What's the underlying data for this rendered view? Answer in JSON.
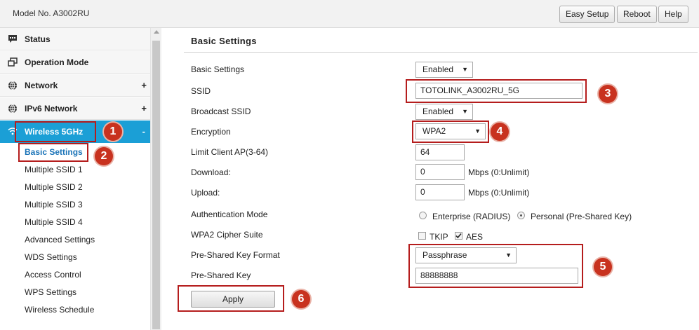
{
  "header": {
    "model": "Model No. A3002RU",
    "buttons": {
      "easy_setup": "Easy Setup",
      "reboot": "Reboot",
      "help": "Help"
    }
  },
  "sidebar": {
    "menu": [
      {
        "label": "Status",
        "icon": "comment-icon",
        "expandable": false
      },
      {
        "label": "Operation Mode",
        "icon": "windows-icon",
        "expandable": false
      },
      {
        "label": "Network",
        "icon": "globe-icon",
        "expandable": true,
        "marker": "+"
      },
      {
        "label": "IPv6 Network",
        "icon": "globe-icon",
        "expandable": true,
        "marker": "+"
      },
      {
        "label": "Wireless 5GHz",
        "icon": "wifi-icon",
        "expandable": true,
        "marker": "-",
        "active": true
      }
    ],
    "submenu": [
      "Basic Settings",
      "Multiple SSID 1",
      "Multiple SSID 2",
      "Multiple SSID 3",
      "Multiple SSID 4",
      "Advanced Settings",
      "WDS Settings",
      "Access Control",
      "WPS Settings",
      "Wireless Schedule"
    ],
    "active_submenu": "Basic Settings"
  },
  "main": {
    "title": "Basic Settings",
    "fields": {
      "basic_settings": {
        "label": "Basic Settings",
        "value": "Enabled"
      },
      "ssid": {
        "label": "SSID",
        "value": "TOTOLINK_A3002RU_5G"
      },
      "broadcast_ssid": {
        "label": "Broadcast SSID",
        "value": "Enabled"
      },
      "encryption": {
        "label": "Encryption",
        "value": "WPA2"
      },
      "limit_client": {
        "label": "Limit Client AP(3-64)",
        "value": "64"
      },
      "download": {
        "label": "Download:",
        "value": "0",
        "unit": "Mbps (0:Unlimit)"
      },
      "upload": {
        "label": "Upload:",
        "value": "0",
        "unit": "Mbps (0:Unlimit)"
      },
      "auth_mode": {
        "label": "Authentication Mode",
        "option_enterprise": "Enterprise (RADIUS)",
        "option_personal": "Personal (Pre-Shared Key)",
        "selected": "Personal (Pre-Shared Key)"
      },
      "cipher_suite": {
        "label": "WPA2 Cipher Suite",
        "tkip": "TKIP",
        "aes": "AES",
        "tkip_checked": false,
        "aes_checked": true
      },
      "psk_format": {
        "label": "Pre-Shared Key Format",
        "value": "Passphrase"
      },
      "psk": {
        "label": "Pre-Shared Key",
        "value": "88888888"
      }
    },
    "apply_label": "Apply"
  },
  "annotations": [
    "1",
    "2",
    "3",
    "4",
    "5",
    "6"
  ],
  "colors": {
    "accent_blue": "#1b9fd6",
    "callout_red": "#b51d1d",
    "badge_red": "#c8321f"
  }
}
